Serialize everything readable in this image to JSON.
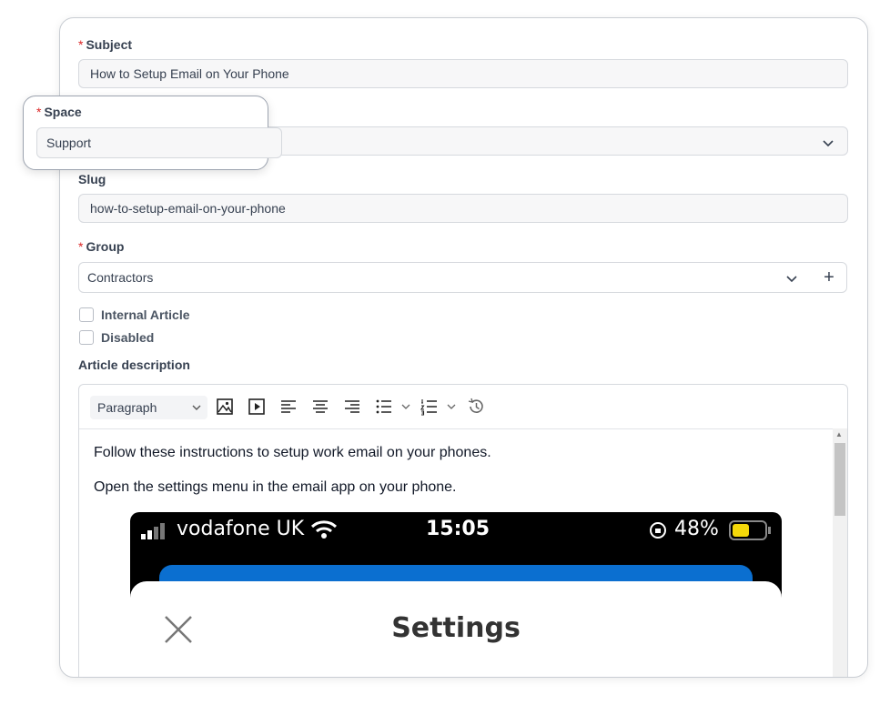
{
  "form": {
    "subject": {
      "required": "*",
      "label": "Subject",
      "value": "How to Setup Email on Your Phone"
    },
    "space": {
      "required": "*",
      "label": "Space",
      "value": "Support"
    },
    "slug": {
      "label": "Slug",
      "value": "how-to-setup-email-on-your-phone"
    },
    "group": {
      "required": "*",
      "label": "Group",
      "value": "Contractors",
      "add_label": "+"
    },
    "internal_article": {
      "label": "Internal Article",
      "checked": false
    },
    "disabled": {
      "label": "Disabled",
      "checked": false
    },
    "description": {
      "label": "Article description"
    }
  },
  "editor": {
    "block_format": "Paragraph",
    "toolbar_icons": [
      "image-icon",
      "video-icon",
      "align-left-icon",
      "align-center-icon",
      "align-right-icon",
      "bullet-list-icon",
      "numbered-list-icon",
      "history-icon"
    ],
    "paragraphs": [
      "Follow these instructions to setup work email on your phones.",
      "Open the settings menu in the email app on your phone."
    ],
    "screenshot": {
      "carrier": "vodafone UK",
      "time": "15:05",
      "battery": "48%",
      "title": "Settings",
      "battery_color": "#f5d90a",
      "bar_color": "#0b6fd0"
    }
  },
  "colors": {
    "required": "#dc2626",
    "border": "#d6d9de",
    "field_bg": "#f7f7f8"
  }
}
